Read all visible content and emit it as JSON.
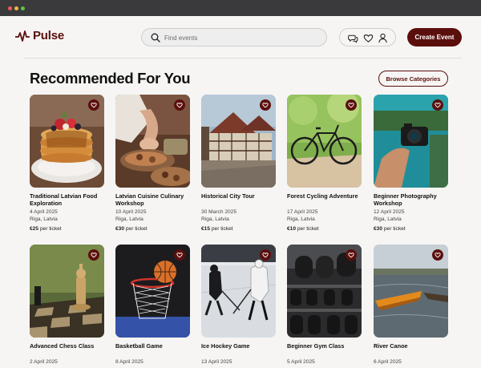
{
  "app": {
    "name": "Pulse"
  },
  "search": {
    "placeholder": "Find events"
  },
  "header": {
    "create_label": "Create Event"
  },
  "section": {
    "title": "Recommended For You",
    "browse_label": "Browse Categories"
  },
  "price_suffix": "per ticket",
  "icons": [
    "pulse-logo-icon",
    "search-icon",
    "chat-icon",
    "heart-icon",
    "user-icon"
  ],
  "colors": {
    "brand": "#5b0f0c",
    "background": "#f6f5f4"
  },
  "cards": [
    {
      "title": "Traditional Latvian Food Exploration",
      "date": "4 April 2025",
      "location": "Riga, Latvia",
      "price": "€25",
      "image": "pancakes"
    },
    {
      "title": "Latvian Cuisine Culinary Workshop",
      "date": "10 April 2025",
      "location": "Riga, Latvia",
      "price": "€30",
      "image": "cooking"
    },
    {
      "title": "Historical City Tour",
      "date": "30 March 2025",
      "location": "Riga, Latvia",
      "price": "€15",
      "image": "old-town"
    },
    {
      "title": "Forest Cycling Adventure",
      "date": "17 April 2025",
      "location": "Riga, Latvia",
      "price": "€10",
      "image": "bicycle"
    },
    {
      "title": "Beginner Photography Workshop",
      "date": "12 April 2025",
      "location": "Riga, Latvia",
      "price": "€30",
      "image": "camera"
    },
    {
      "title": "Advanced Chess Class",
      "date": "2 April 2025",
      "location": "",
      "price": "",
      "image": "chess"
    },
    {
      "title": "Basketball Game",
      "date": "8 April 2025",
      "location": "",
      "price": "",
      "image": "basketball"
    },
    {
      "title": "Ice Hockey Game",
      "date": "13 April 2025",
      "location": "",
      "price": "",
      "image": "hockey"
    },
    {
      "title": "Beginner Gym Class",
      "date": "5 April 2025",
      "location": "",
      "price": "",
      "image": "gym"
    },
    {
      "title": "River Canoe",
      "date": "6 April 2025",
      "location": "",
      "price": "",
      "image": "canoe"
    }
  ]
}
